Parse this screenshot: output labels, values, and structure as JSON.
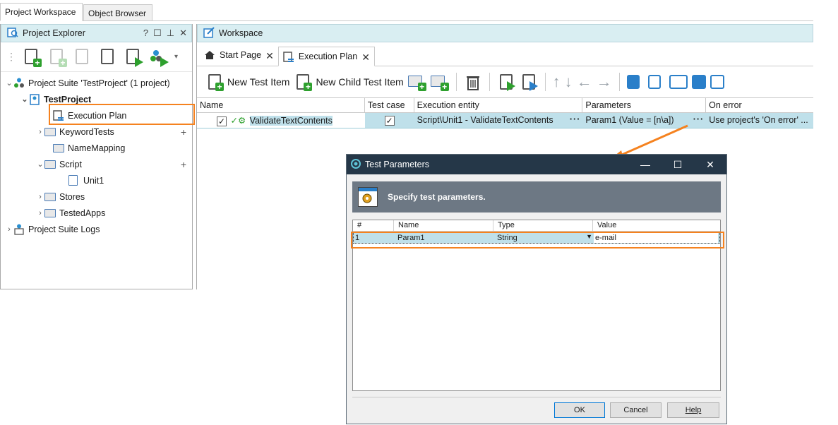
{
  "top_tabs": [
    {
      "label": "Project Workspace",
      "active": true
    },
    {
      "label": "Object Browser",
      "active": false
    }
  ],
  "explorer": {
    "title": "Project Explorer",
    "header_buttons": [
      "?",
      "☐",
      "⊥",
      "✕"
    ],
    "tree": {
      "suite": "Project Suite 'TestProject' (1 project)",
      "project": "TestProject",
      "execution_plan": "Execution Plan",
      "keyword_tests": "KeywordTests",
      "name_mapping": "NameMapping",
      "script": "Script",
      "unit1": "Unit1",
      "stores": "Stores",
      "tested_apps": "TestedApps",
      "logs": "Project Suite Logs"
    }
  },
  "workspace": {
    "title": "Workspace",
    "tabs": [
      {
        "label": "Start Page"
      },
      {
        "label": "Execution Plan"
      }
    ],
    "toolbar": {
      "new_test_item": "New Test Item",
      "new_child_test_item": "New Child Test Item"
    },
    "grid": {
      "columns": [
        "Name",
        "Test case",
        "Execution entity",
        "Parameters",
        "On error"
      ],
      "row": {
        "name": "ValidateTextContents",
        "test_case": "✓",
        "execution_entity": "Script\\Unit1 - ValidateTextContents",
        "parameters": "Param1 (Value = [n\\a])",
        "on_error": "Use project's 'On error' ..."
      }
    }
  },
  "dialog": {
    "title": "Test Parameters",
    "window_buttons": [
      "—",
      "☐",
      "✕"
    ],
    "banner": "Specify test parameters.",
    "columns": [
      "#",
      "Name",
      "Type",
      "Value"
    ],
    "rows": [
      {
        "num": "1",
        "name": "Param1",
        "type": "String",
        "value": "e-mail"
      }
    ],
    "buttons": {
      "ok": "OK",
      "cancel": "Cancel",
      "help": "Help"
    }
  },
  "colors": {
    "highlight": "#f5821f",
    "dialog_title_bar": "#253748",
    "selected_row": "#bfe0ea",
    "panel_header": "#d9eef2"
  }
}
